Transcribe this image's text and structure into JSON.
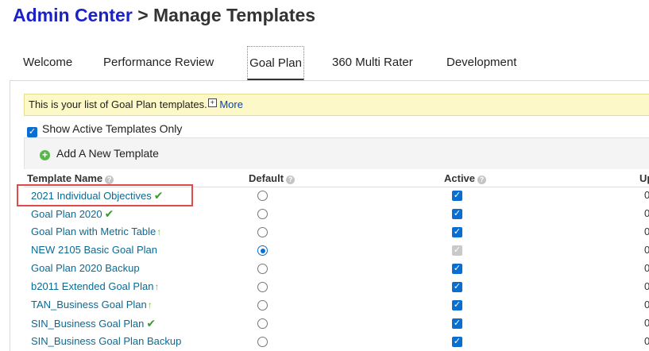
{
  "breadcrumb": {
    "root": "Admin Center",
    "separator": ">",
    "page": "Manage Templates"
  },
  "tabs": [
    {
      "label": "Welcome",
      "active": false
    },
    {
      "label": "Performance Review",
      "active": false
    },
    {
      "label": "Goal Plan",
      "active": true
    },
    {
      "label": "360 Multi Rater",
      "active": false
    },
    {
      "label": "Development",
      "active": false
    }
  ],
  "info": {
    "text": "This is your list of Goal Plan templates.",
    "plus": "+",
    "more": "More"
  },
  "filter": {
    "label": "Show Active Templates Only",
    "checked": true
  },
  "toolbar": {
    "add_label": "Add A New Template",
    "add_symbol": "+"
  },
  "table": {
    "columns": {
      "name": "Template Name",
      "default": "Default",
      "active": "Active",
      "updated": "Up"
    },
    "help_symbol": "?",
    "rows": [
      {
        "name": "2021 Individual Objectives",
        "badge": "✔",
        "default": false,
        "active": true,
        "active_disabled": false,
        "updated": "0"
      },
      {
        "name": "Goal Plan 2020",
        "badge": "✔",
        "default": false,
        "active": true,
        "active_disabled": false,
        "updated": "0"
      },
      {
        "name": "Goal Plan with Metric Table",
        "badge": "↑",
        "default": false,
        "active": true,
        "active_disabled": false,
        "updated": "0"
      },
      {
        "name": "NEW 2105 Basic Goal Plan",
        "badge": "",
        "default": true,
        "active": true,
        "active_disabled": true,
        "updated": "0"
      },
      {
        "name": "Goal Plan 2020 Backup",
        "badge": "",
        "default": false,
        "active": true,
        "active_disabled": false,
        "updated": "0"
      },
      {
        "name": "b2011 Extended Goal Plan",
        "badge": "↑",
        "default": false,
        "active": true,
        "active_disabled": false,
        "updated": "0"
      },
      {
        "name": "TAN_Business Goal Plan",
        "badge": "↑",
        "default": false,
        "active": true,
        "active_disabled": false,
        "updated": "0"
      },
      {
        "name": "SIN_Business Goal Plan",
        "badge": "✔",
        "default": false,
        "active": true,
        "active_disabled": false,
        "updated": "0"
      },
      {
        "name": "SIN_Business Goal Plan Backup",
        "badge": "",
        "default": false,
        "active": true,
        "active_disabled": false,
        "updated": "0"
      }
    ]
  },
  "colors": {
    "title_link": "#1a22c8",
    "row_link": "#0b6a93",
    "checkbox": "#0a6ed1",
    "highlight": "#e04a4a",
    "info_bg": "#fdf8c7"
  }
}
